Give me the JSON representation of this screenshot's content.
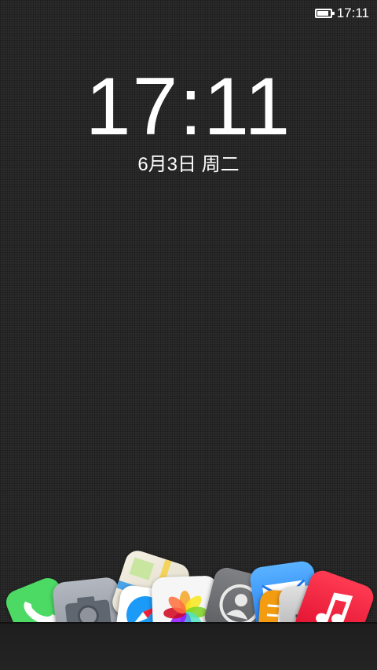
{
  "status_bar": {
    "time": "17:11",
    "battery_level": 0.9,
    "battery_icon": "battery-icon"
  },
  "lockscreen": {
    "time": "17:11",
    "date": "6月3日 周二"
  },
  "dock_apps": [
    {
      "icon": "phone-icon",
      "color": "#4cd964"
    },
    {
      "icon": "camera-icon",
      "color": "#9ea3ad"
    },
    {
      "icon": "maps-icon",
      "color": "#e9e6dc"
    },
    {
      "icon": "safari-icon",
      "color": "#ffffff"
    },
    {
      "icon": "photos-icon",
      "color": "#f4f4f4"
    },
    {
      "icon": "contacts-icon",
      "color": "#6f7072"
    },
    {
      "icon": "mail-icon",
      "color": "#2a88f5"
    },
    {
      "icon": "notes-icon",
      "color": "#f39c12"
    },
    {
      "icon": "settings-icon",
      "color": "#d0d0d0"
    },
    {
      "icon": "music-icon",
      "color": "#f0203a"
    }
  ]
}
